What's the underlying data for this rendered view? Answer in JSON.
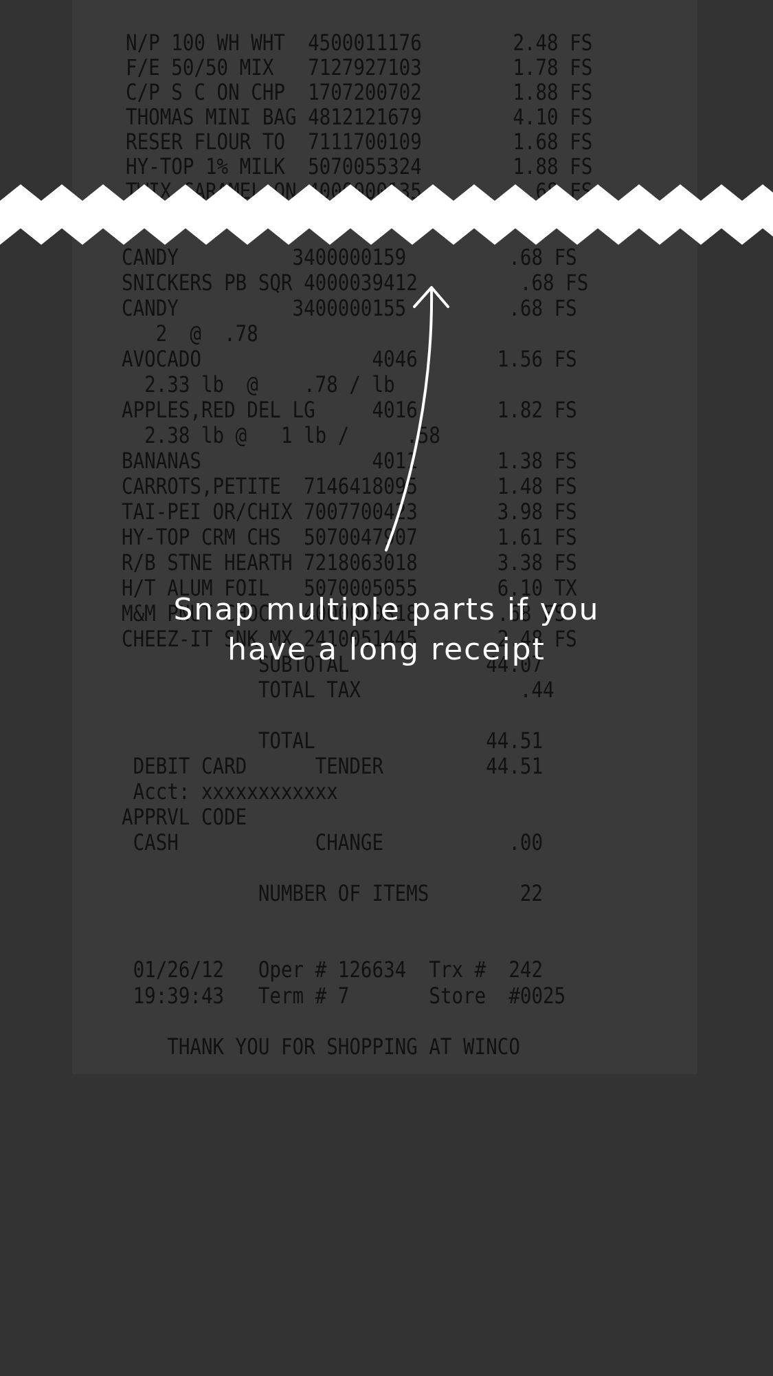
{
  "receipt": {
    "lines": [
      "N/P 100 WH WHT  4500011176        2.48 FS",
      "F/E 50/50 MIX   7127927103        1.78 FS",
      "C/P S C ON CHP  1707200702        1.88 FS",
      "THOMAS MINI BAG 4812121679        4.10 FS",
      "RESER FLOUR TO  7111700109        1.68 FS",
      "HY-TOP 1% MILK  5070055324        1.88 FS",
      "TWIX CARAMEL ON 4000000135         .68 FS",
      "CANDY          3400000159         .68 FS",
      "SNICKERS PB SQR 4000039412         .68 FS",
      "CANDY          3400000155         .68 FS",
      "   2  @  .78",
      "AVOCADO               4046       1.56 FS",
      "  2.33 lb  @    .78 / lb",
      "APPLES,RED DEL LG     4016       1.82 FS",
      "  2.38 lb @   1 lb /     .58",
      "BANANAS               4011       1.38 FS",
      "CARROTS,PETITE  7146418095       1.48 FS",
      "TAI-PEI OR/CHIX 7007700423       3.98 FS",
      "HY-TOP CRM CHS  5070047907       1.61 FS",
      "R/B STNE HEARTH 7218063018       3.38 FS",
      "H/T ALUM FOIL   5070005055       6.10 TX",
      "M&M PNUT CHOC   4000000318       .68 FS",
      "CHEEZ-IT SNK MX 2410051445       2.48 FS",
      "            SUBTOTAL            44.07",
      "            TOTAL TAX              .44",
      "",
      "            TOTAL               44.51",
      " DEBIT CARD      TENDER         44.51",
      " Acct: xxxxxxxxxxxx",
      "APPRVL CODE",
      " CASH            CHANGE           .00",
      "",
      "            NUMBER OF ITEMS        22",
      "",
      "",
      " 01/26/12   Oper # 126634  Trx #  242",
      " 19:39:43   Term # 7       Store  #0025",
      "",
      "    THANK YOU FOR SHOPPING AT WINCO"
    ]
  },
  "overlay": {
    "line1": "Snap multiple parts if you",
    "line2": "have a long receipt"
  },
  "colors": {
    "background": "#333333",
    "overlay_text": "#ffffff",
    "tear": "#ffffff"
  }
}
